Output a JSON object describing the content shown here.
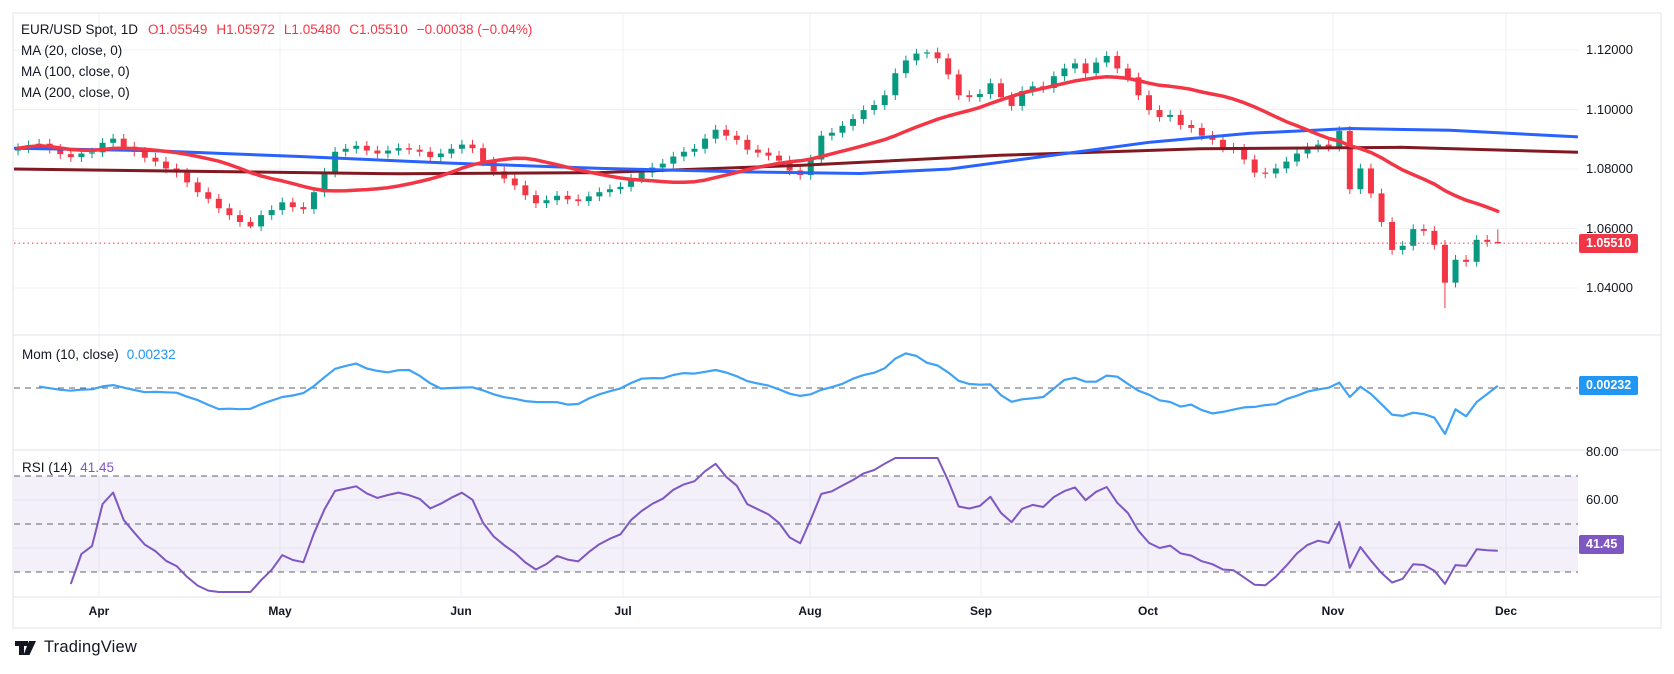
{
  "header": {
    "symbol_line": {
      "title": "EUR/USD Spot, 1D",
      "open": "O1.05549",
      "high": "H1.05972",
      "low": "L1.05480",
      "close": "C1.05510",
      "change": "−0.00038 (−0.04%)"
    },
    "ma_labels": [
      "MA (20, close, 0)",
      "MA (100, close, 0)",
      "MA (200, close, 0)"
    ]
  },
  "panels": {
    "momentum": {
      "label": "Mom (10, close)",
      "value": "0.00232",
      "badge": "0.00232"
    },
    "rsi": {
      "label": "RSI (14)",
      "value": "41.45",
      "badge": "41.45"
    }
  },
  "price_axis": {
    "labels": [
      {
        "text": "1.12000",
        "price": 1.12
      },
      {
        "text": "1.10000",
        "price": 1.1
      },
      {
        "text": "1.08000",
        "price": 1.08
      },
      {
        "text": "1.06000",
        "price": 1.06
      },
      {
        "text": "1.04000",
        "price": 1.04
      }
    ],
    "last_price_badge": "1.05510",
    "last_price": 1.0551
  },
  "rsi_axis": {
    "labels": [
      {
        "text": "80.00",
        "value": 80
      },
      {
        "text": "60.00",
        "value": 60
      }
    ]
  },
  "time_axis": {
    "months": [
      "Apr",
      "May",
      "Jun",
      "Jul",
      "Aug",
      "Sep",
      "Oct",
      "Nov",
      "Dec"
    ]
  },
  "footer": {
    "logo_text": "TradingView"
  },
  "colors": {
    "up": "#089981",
    "down": "#f23645",
    "ma20": "#f23645",
    "ma100": "#2962ff",
    "ma200": "#801922",
    "mom_line": "#3fa2f5",
    "mom_badge": "#2196f3",
    "rsi_line": "#7e57c2",
    "rsi_badge": "#7e57c2",
    "rsi_band": "rgba(126,87,194,0.09)",
    "price_line": "#f23645",
    "grid": "#eef0f4",
    "separator": "#e0e3eb",
    "dash": "#5f636e"
  },
  "chart_data": {
    "type": "candlestick",
    "symbol": "EUR/USD Spot",
    "interval": "1D",
    "last_candle": {
      "open": 1.05549,
      "high": 1.05972,
      "low": 1.0548,
      "close": 1.0551,
      "change": -0.00038,
      "change_pct": -0.04
    },
    "ylim": [
      1.033,
      1.125
    ],
    "price_gridlines": [
      1.12,
      1.1,
      1.08,
      1.06,
      1.04
    ],
    "closes": [
      1.087,
      1.088,
      1.0885,
      1.0868,
      1.085,
      1.084,
      1.0852,
      1.0856,
      1.0888,
      1.0902,
      1.0875,
      1.0858,
      1.0838,
      1.0825,
      1.0802,
      1.0788,
      1.0755,
      1.0722,
      1.07,
      1.0668,
      1.0645,
      1.0622,
      1.0607,
      1.0645,
      1.0662,
      1.0688,
      1.0672,
      1.0665,
      1.0722,
      1.0788,
      1.0858,
      1.0868,
      1.0878,
      1.0862,
      1.0852,
      1.0862,
      1.087,
      1.0865,
      1.0858,
      1.084,
      1.0852,
      1.0868,
      1.0882,
      1.087,
      1.0825,
      1.0792,
      1.0768,
      1.0745,
      1.0712,
      1.0685,
      1.0695,
      1.071,
      1.0698,
      1.0692,
      1.0708,
      1.0722,
      1.0732,
      1.074,
      1.0768,
      1.0788,
      1.0805,
      1.0818,
      1.0842,
      1.0858,
      1.0868,
      1.0902,
      1.0932,
      1.0912,
      1.0898,
      1.0865,
      1.0855,
      1.0845,
      1.0828,
      1.0795,
      1.078,
      1.0832,
      1.0912,
      1.0922,
      1.0945,
      1.0968,
      1.0998,
      1.1015,
      1.1048,
      1.1122,
      1.1165,
      1.1188,
      1.1192,
      1.1172,
      1.1118,
      1.1048,
      1.1042,
      1.1052,
      1.1088,
      1.1042,
      1.1012,
      1.1062,
      1.1078,
      1.1072,
      1.1112,
      1.1138,
      1.1155,
      1.1122,
      1.1158,
      1.118,
      1.1138,
      1.1108,
      1.1048,
      1.0998,
      1.0975,
      1.0982,
      1.0948,
      1.0938,
      1.0912,
      1.0898,
      1.0872,
      1.0868,
      1.0832,
      1.0788,
      1.0785,
      1.0802,
      1.0825,
      1.0852,
      1.0872,
      1.0882,
      1.0875,
      1.0928,
      1.0732,
      1.0802,
      1.0718,
      1.0622,
      1.0528,
      1.0542,
      1.0598,
      1.0592,
      1.0545,
      1.0418,
      1.0495,
      1.0488,
      1.0562,
      1.0555,
      1.0551
    ],
    "wick": 0.0016,
    "overrides": {
      "22": {
        "low": 1.0601
      },
      "86": {
        "high": 1.1202
      },
      "135": {
        "low": 1.0333
      },
      "140": {
        "open": 1.05549,
        "high": 1.05972,
        "low": 1.0548,
        "close": 1.0551
      }
    },
    "ma20_period": 20,
    "ma100_points": [
      [
        14,
        1.087
      ],
      [
        150,
        1.0862
      ],
      [
        300,
        1.0842
      ],
      [
        450,
        1.082
      ],
      [
        600,
        1.0802
      ],
      [
        750,
        1.079
      ],
      [
        860,
        1.0785
      ],
      [
        950,
        1.08
      ],
      [
        1050,
        1.0845
      ],
      [
        1150,
        1.089
      ],
      [
        1250,
        1.092
      ],
      [
        1350,
        1.0936
      ],
      [
        1450,
        1.093
      ],
      [
        1578,
        1.0908
      ]
    ],
    "ma200_points": [
      [
        14,
        1.08
      ],
      [
        200,
        1.0792
      ],
      [
        400,
        1.0784
      ],
      [
        600,
        1.0788
      ],
      [
        800,
        1.0812
      ],
      [
        1000,
        1.0846
      ],
      [
        1200,
        1.0868
      ],
      [
        1400,
        1.0873
      ],
      [
        1578,
        1.0856
      ]
    ],
    "momentum": {
      "period": 10,
      "last": 0.00232
    },
    "rsi": {
      "period": 14,
      "last": 41.45,
      "levels": [
        70,
        50,
        30
      ]
    }
  }
}
